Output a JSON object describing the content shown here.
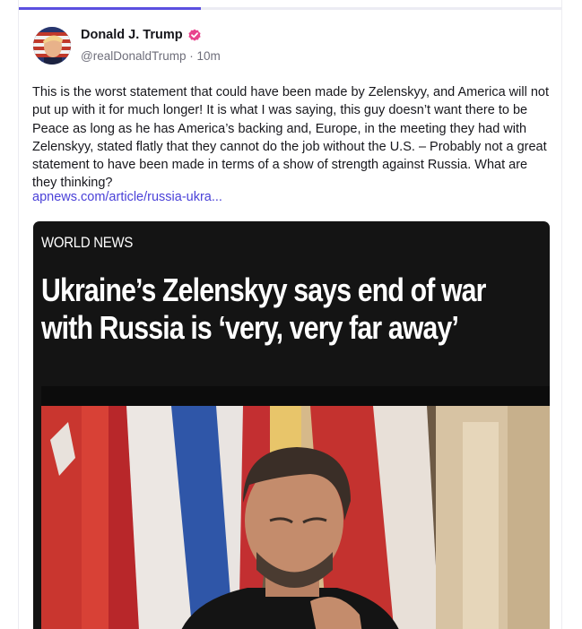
{
  "post": {
    "author_name": "Donald J. Trump",
    "handle": "@realDonaldTrump",
    "separator": "·",
    "time": "10m",
    "text": "This is the worst statement that could have been made by Zelenskyy, and America will not put up with it for much longer! It is what I was saying, this guy doesn’t want there to be Peace as long as he has America’s backing and, Europe, in the meeting they had with Zelenskyy, stated flatly that they cannot do the job without the U.S. – Probably not a great statement to have been made in terms of a show of strength against Russia. What are they thinking?",
    "link_text": "apnews.com/article/russia-ukra..."
  },
  "card": {
    "tag": "WORLD NEWS",
    "title": "Ukraine’s Zelenskyy says end of war with Russia is ‘very, very far away’"
  },
  "colors": {
    "accent": "#5b4fe0",
    "link": "#4a41d8",
    "verified_badge": "#e8428c",
    "card_background": "#141414"
  },
  "icons": {
    "verified": "verified-badge-icon",
    "avatar": "avatar"
  }
}
